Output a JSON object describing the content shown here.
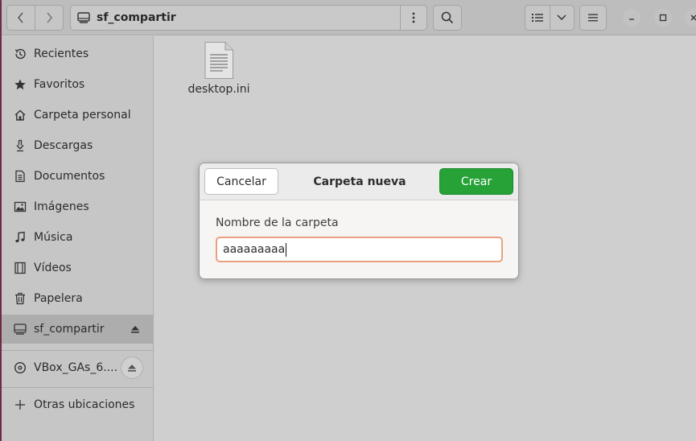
{
  "header": {
    "back_icon": "chevron-left-icon",
    "forward_icon": "chevron-right-icon",
    "location_title": "sf_compartir",
    "location_icon": "drive-icon",
    "path_menu_icon": "vertical-dots-icon",
    "search_icon": "search-icon",
    "view_list_icon": "list-view-icon",
    "view_options_icon": "chevron-down-icon",
    "main_menu_icon": "hamburger-icon"
  },
  "window_controls": {
    "minimize": "–",
    "maximize": "□",
    "close": "×"
  },
  "sidebar": {
    "items": [
      {
        "label": "Recientes",
        "icon": "clock-icon"
      },
      {
        "label": "Favoritos",
        "icon": "star-icon"
      },
      {
        "label": "Carpeta personal",
        "icon": "home-icon"
      },
      {
        "label": "Descargas",
        "icon": "download-icon"
      },
      {
        "label": "Documentos",
        "icon": "document-icon"
      },
      {
        "label": "Imágenes",
        "icon": "image-icon"
      },
      {
        "label": "Música",
        "icon": "music-icon"
      },
      {
        "label": "Vídeos",
        "icon": "video-icon"
      },
      {
        "label": "Papelera",
        "icon": "trash-icon"
      }
    ],
    "devices": [
      {
        "label": "sf_compartir",
        "icon": "drive-icon",
        "active": true,
        "eject": "eject-icon"
      },
      {
        "label": "VBox_GAs_6....",
        "icon": "disc-icon",
        "active": false,
        "eject": "eject-icon"
      }
    ],
    "other": {
      "label": "Otras ubicaciones",
      "icon": "plus-icon"
    }
  },
  "content": {
    "files": [
      {
        "name": "desktop.ini",
        "icon": "text-file-icon"
      }
    ]
  },
  "dialog": {
    "title": "Carpeta nueva",
    "cancel_label": "Cancelar",
    "create_label": "Crear",
    "field_label": "Nombre de la carpeta",
    "field_value": "aaaaaaaaa"
  },
  "colors": {
    "accent_green": "#26a236",
    "focus_border": "#e8a07f",
    "window_border": "#6e2a4a"
  }
}
